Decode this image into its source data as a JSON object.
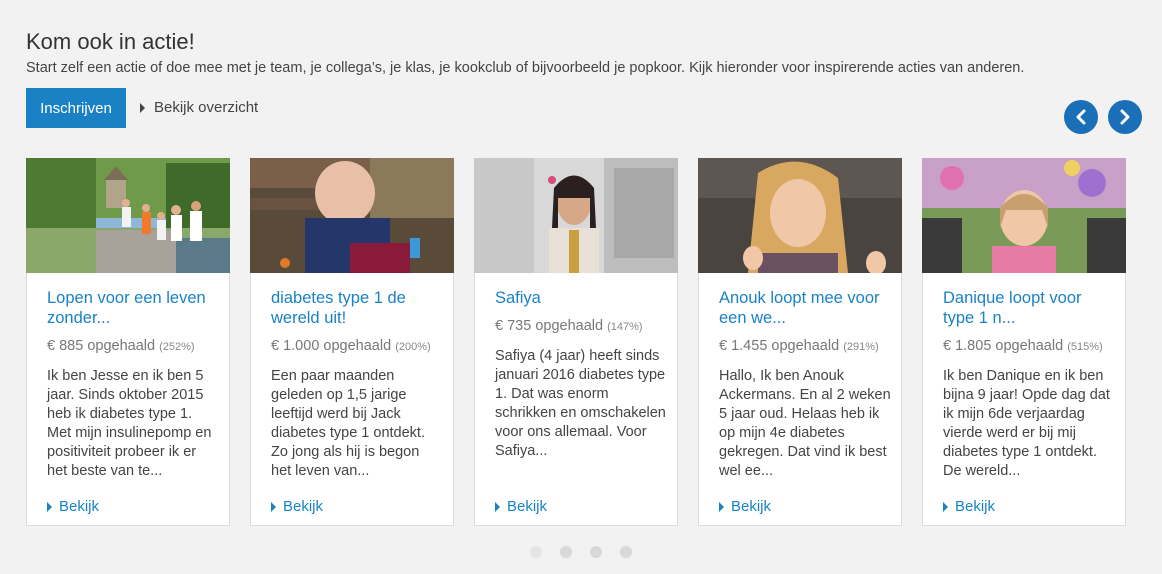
{
  "header": {
    "title": "Kom ook in actie!",
    "subtitle": "Start zelf een actie of doe mee met je team, je collega’s, je klas, je kookclub of bijvoorbeeld je popkoor. Kijk hieronder voor inspirerende acties van anderen.",
    "signup_label": "Inschrijven",
    "overview_label": "Bekijk overzicht"
  },
  "carousel": {
    "prev_icon": "chevron-left-icon",
    "next_icon": "chevron-right-icon",
    "arrow_color": "#1a6fb8",
    "dots_count": 4
  },
  "cards": [
    {
      "title": "Lopen voor een leven zonder...",
      "raised": "€ 885 opgehaald",
      "percent": "(252%)",
      "description": "Ik ben Jesse en ik ben 5 jaar. Sinds oktober 2015 heb ik diabetes type 1. Met mijn insulinepomp en positiviteit probeer ik er het beste van te...",
      "view_label": "Bekijk",
      "image": "group-walking-photo"
    },
    {
      "title": "diabetes type 1 de wereld uit!",
      "raised": "€ 1.000 opgehaald",
      "percent": "(200%)",
      "description": "Een paar maanden geleden op 1,5 jarige leeftijd werd bij Jack diabetes type 1 ontdekt. Zo jong als hij is begon het leven van...",
      "view_label": "Bekijk",
      "image": "toddler-on-bench-photo"
    },
    {
      "title": "Safiya",
      "raised": "€ 735 opgehaald",
      "percent": "(147%)",
      "description": "Safiya (4 jaar) heeft sinds januari 2016 diabetes type 1. Dat was enorm schrikken en omschakelen voor ons allemaal. Voor Safiya...",
      "view_label": "Bekijk",
      "image": "girl-in-kitchen-photo"
    },
    {
      "title": "Anouk loopt mee voor een we...",
      "raised": "€ 1.455 opgehaald",
      "percent": "(291%)",
      "description": "Hallo, Ik ben Anouk Ackermans. En al 2 weken 5 jaar oud. Helaas heb ik op mijn 4e diabetes gekregen. Dat vind ik best wel ee...",
      "view_label": "Bekijk",
      "image": "girl-thumbs-up-photo"
    },
    {
      "title": "Danique loopt voor type 1 n...",
      "raised": "€ 1.805 opgehaald",
      "percent": "(515%)",
      "description": "Ik ben Danique en ik ben bijna 9 jaar! Opde dag dat ik mijn 6de verjaardag vierde werd er bij mij diabetes type 1 ontdekt. De wereld...",
      "view_label": "Bekijk",
      "image": "girl-at-fair-photo"
    }
  ]
}
